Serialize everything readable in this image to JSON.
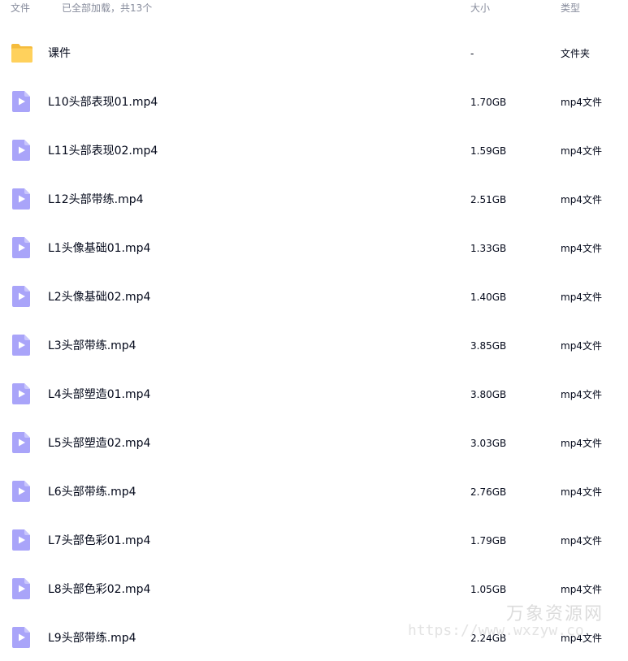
{
  "header": {
    "name_label": "文件",
    "count_label": "已全部加载，共13个",
    "size_label": "大小",
    "type_label": "类型"
  },
  "files": [
    {
      "name": "课件",
      "size": "-",
      "type": "文件夹",
      "icon": "folder-icon"
    },
    {
      "name": "L10头部表现01.mp4",
      "size": "1.70GB",
      "type": "mp4文件",
      "icon": "video-file-icon"
    },
    {
      "name": "L11头部表现02.mp4",
      "size": "1.59GB",
      "type": "mp4文件",
      "icon": "video-file-icon"
    },
    {
      "name": "L12头部带练.mp4",
      "size": "2.51GB",
      "type": "mp4文件",
      "icon": "video-file-icon"
    },
    {
      "name": "L1头像基础01.mp4",
      "size": "1.33GB",
      "type": "mp4文件",
      "icon": "video-file-icon"
    },
    {
      "name": "L2头像基础02.mp4",
      "size": "1.40GB",
      "type": "mp4文件",
      "icon": "video-file-icon"
    },
    {
      "name": "L3头部带练.mp4",
      "size": "3.85GB",
      "type": "mp4文件",
      "icon": "video-file-icon"
    },
    {
      "name": "L4头部塑造01.mp4",
      "size": "3.80GB",
      "type": "mp4文件",
      "icon": "video-file-icon"
    },
    {
      "name": "L5头部塑造02.mp4",
      "size": "3.03GB",
      "type": "mp4文件",
      "icon": "video-file-icon"
    },
    {
      "name": "L6头部带练.mp4",
      "size": "2.76GB",
      "type": "mp4文件",
      "icon": "video-file-icon"
    },
    {
      "name": "L7头部色彩01.mp4",
      "size": "1.79GB",
      "type": "mp4文件",
      "icon": "video-file-icon"
    },
    {
      "name": "L8头部色彩02.mp4",
      "size": "1.05GB",
      "type": "mp4文件",
      "icon": "video-file-icon"
    },
    {
      "name": "L9头部带练.mp4",
      "size": "2.24GB",
      "type": "mp4文件",
      "icon": "video-file-icon"
    }
  ],
  "watermark": {
    "title": "万象资源网",
    "url": "https://www.wxzyw.co"
  },
  "colors": {
    "folder": "#ffd15c",
    "folder_dark": "#f5bc3d",
    "video": "#a9a4f9",
    "video_fold": "#c9c6fc",
    "header_text": "#878c9c",
    "text": "#03081a"
  }
}
